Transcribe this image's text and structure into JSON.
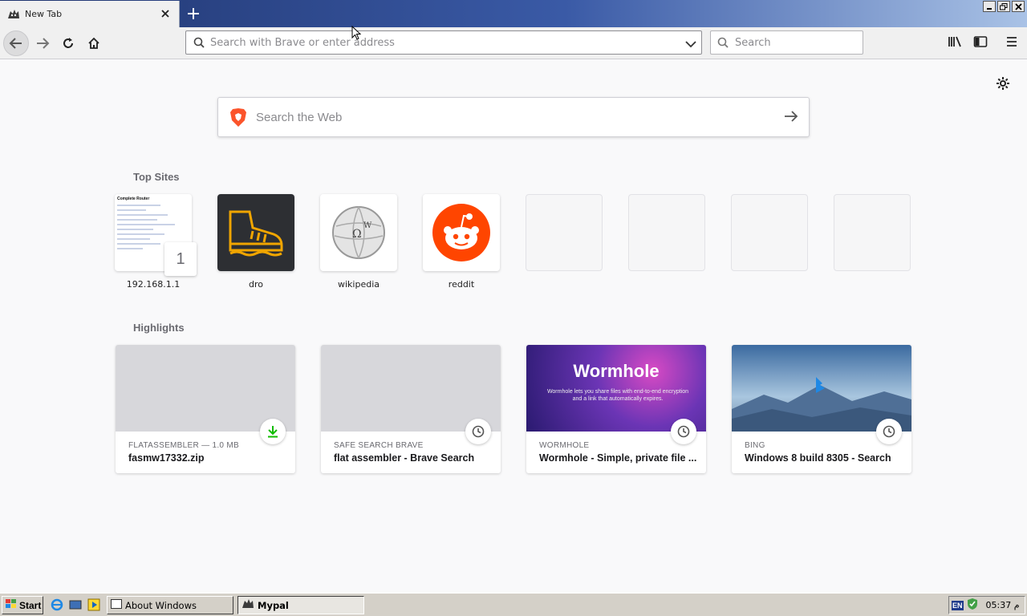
{
  "tab": {
    "title": "New Tab"
  },
  "urlbar": {
    "placeholder": "Search with Brave or enter address"
  },
  "searchbar": {
    "placeholder": "Search"
  },
  "websearch": {
    "placeholder": "Search the Web"
  },
  "topsites": {
    "title": "Top Sites",
    "items": [
      {
        "label": "192.168.1.1",
        "badge": "1",
        "preview_title": "Complete Router"
      },
      {
        "label": "dro"
      },
      {
        "label": "wikipedia"
      },
      {
        "label": "reddit"
      }
    ]
  },
  "highlights": {
    "title": "Highlights",
    "items": [
      {
        "meta": "FLATASSEMBLER — 1.0 MB",
        "title": "fasmw17332.zip",
        "badge_icon": "download-icon",
        "badge_color": "#12bc00"
      },
      {
        "meta": "SAFE SEARCH BRAVE",
        "title": "flat assembler - Brave Search",
        "badge_icon": "clock-icon"
      },
      {
        "meta": "WORMHOLE",
        "title": "Wormhole - Simple, private file ...",
        "badge_icon": "clock-icon",
        "image_heading": "Wormhole",
        "image_sub": "Wormhole lets you share files with end-to-end encryption and a link that automatically expires."
      },
      {
        "meta": "BING",
        "title": "Windows 8 build 8305 - Search",
        "badge_icon": "clock-icon"
      }
    ]
  },
  "taskbar": {
    "start": "Start",
    "tasks": [
      {
        "label": "About Windows"
      },
      {
        "label": "Mypal"
      }
    ],
    "tray_lang": "EN",
    "clock": "05:37 م"
  },
  "colors": {
    "brave": "#fb542b",
    "reddit": "#ff4500",
    "dro_bg": "#2d2f33",
    "dro_boot": "#f0a500",
    "bing": "#1e88e5"
  }
}
